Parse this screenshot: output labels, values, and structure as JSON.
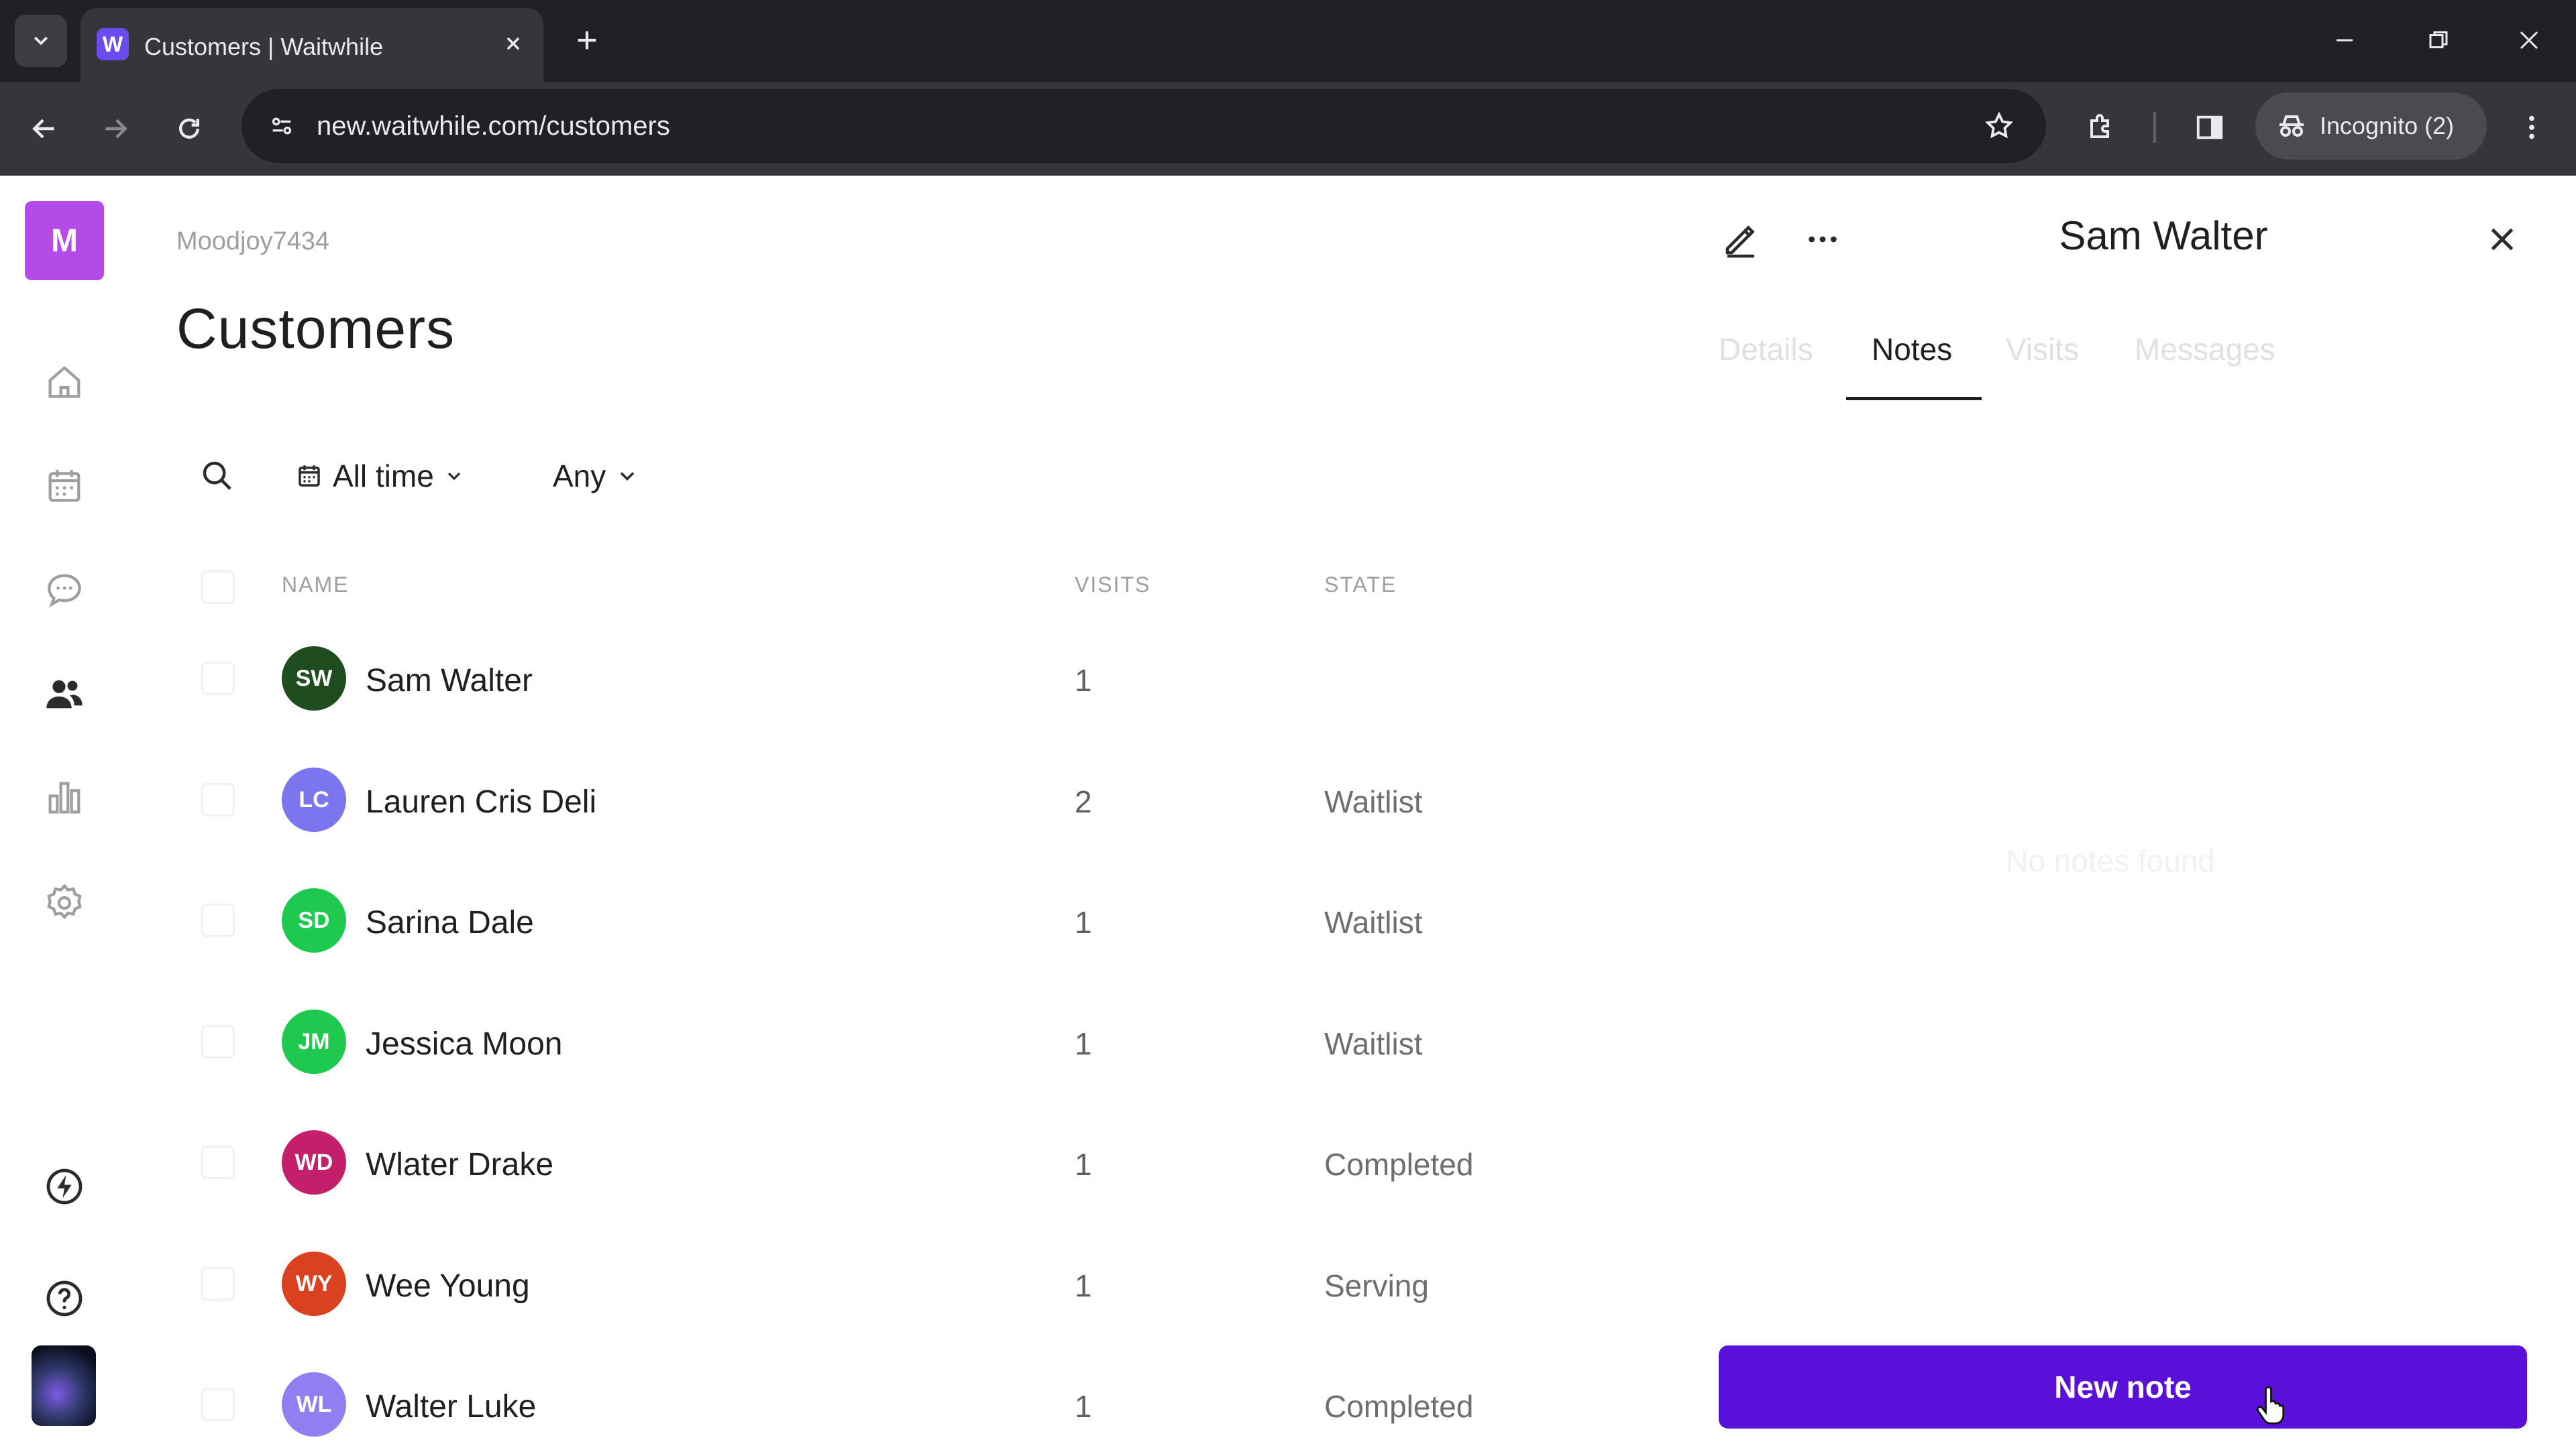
{
  "browser": {
    "tab_title": "Customers | Waitwhile",
    "favicon_letter": "W",
    "url": "new.waitwhile.com/customers",
    "incognito_label": "Incognito (2)"
  },
  "sidebar": {
    "workspace_initial": "M",
    "items": [
      {
        "icon": "home-icon"
      },
      {
        "icon": "calendar-icon"
      },
      {
        "icon": "chat-icon"
      },
      {
        "icon": "customers-icon"
      },
      {
        "icon": "analytics-icon"
      },
      {
        "icon": "settings-icon"
      }
    ],
    "bottom": [
      {
        "icon": "bolt-icon"
      },
      {
        "icon": "help-icon"
      }
    ]
  },
  "main": {
    "breadcrumb": "Moodjoy7434",
    "title": "Customers",
    "filters": {
      "time": "All time",
      "state": "Any"
    },
    "columns": {
      "name": "NAME",
      "visits": "VISITS",
      "state": "STATE"
    },
    "rows": [
      {
        "initials": "SW",
        "name": "Sam Walter",
        "visits": "1",
        "state": "",
        "color": "#1f4d1f"
      },
      {
        "initials": "LC",
        "name": "Lauren Cris Deli",
        "visits": "2",
        "state": "Waitlist",
        "color": "#7b76f0"
      },
      {
        "initials": "SD",
        "name": "Sarina Dale",
        "visits": "1",
        "state": "Waitlist",
        "color": "#1fc84f"
      },
      {
        "initials": "JM",
        "name": "Jessica Moon",
        "visits": "1",
        "state": "Waitlist",
        "color": "#1fc84f"
      },
      {
        "initials": "WD",
        "name": "Wlater Drake",
        "visits": "1",
        "state": "Completed",
        "color": "#c41f6b"
      },
      {
        "initials": "WY",
        "name": "Wee Young",
        "visits": "1",
        "state": "Serving",
        "color": "#d9411f"
      },
      {
        "initials": "WL",
        "name": "Walter Luke",
        "visits": "1",
        "state": "Completed",
        "color": "#8f7ff0"
      }
    ]
  },
  "panel": {
    "title": "Sam Walter",
    "tabs": [
      "Details",
      "Notes",
      "Visits",
      "Messages"
    ],
    "active_tab": "Notes",
    "empty_text": "No notes found",
    "new_note_label": "New note"
  },
  "colors": {
    "accent": "#5a10d9",
    "workspace": "#b44be8"
  }
}
